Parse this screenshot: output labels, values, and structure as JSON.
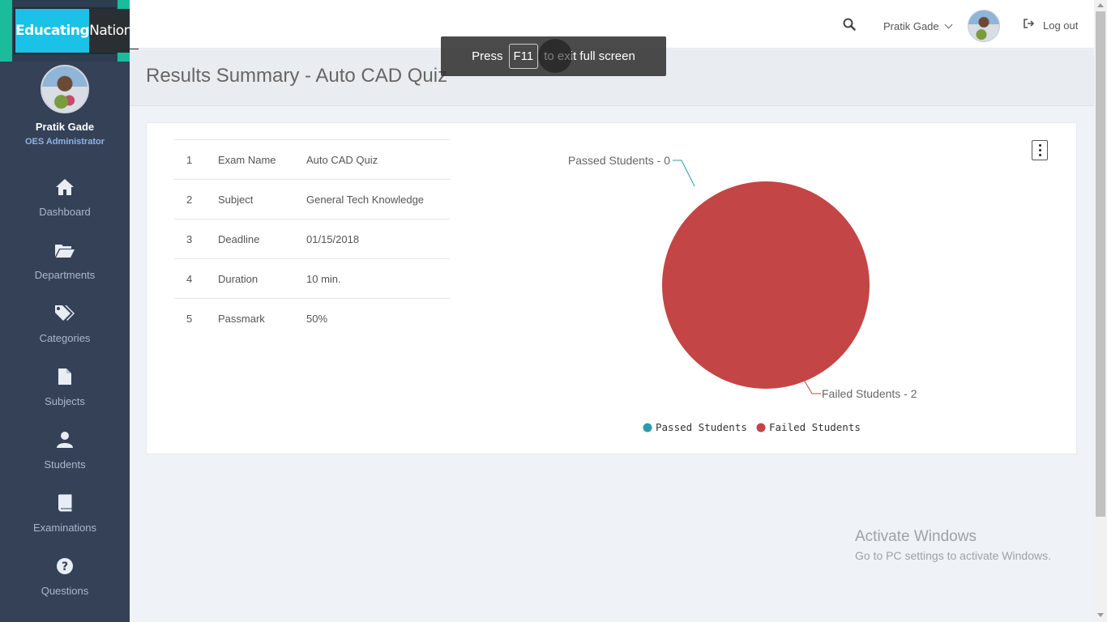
{
  "brand": {
    "logo_left": "Educating",
    "logo_right": "Nations"
  },
  "profile": {
    "name": "Pratik Gade",
    "role": "OES Administrator"
  },
  "nav": [
    {
      "label": "Dashboard",
      "icon": "home-icon"
    },
    {
      "label": "Departments",
      "icon": "folder-open-icon"
    },
    {
      "label": "Categories",
      "icon": "tags-icon"
    },
    {
      "label": "Subjects",
      "icon": "file-icon"
    },
    {
      "label": "Students",
      "icon": "user-icon"
    },
    {
      "label": "Examinations",
      "icon": "book-icon"
    },
    {
      "label": "Questions",
      "icon": "question-circle-icon"
    }
  ],
  "topbar": {
    "user_name": "Pratik Gade",
    "logout_label": "Log out"
  },
  "page": {
    "title": "Results Summary - Auto CAD Quiz"
  },
  "details": [
    {
      "num": "1",
      "key": "Exam Name",
      "value": "Auto CAD Quiz"
    },
    {
      "num": "2",
      "key": "Subject",
      "value": "General Tech Knowledge"
    },
    {
      "num": "3",
      "key": "Deadline",
      "value": "01/15/2018"
    },
    {
      "num": "4",
      "key": "Duration",
      "value": "10 min."
    },
    {
      "num": "5",
      "key": "Passmark",
      "value": "50%"
    }
  ],
  "chart_data": {
    "type": "pie",
    "title": "",
    "series": [
      {
        "name": "Passed Students",
        "value": 0,
        "label": "Passed Students - 0",
        "color": "#2e9aae"
      },
      {
        "name": "Failed Students",
        "value": 2,
        "label": "Failed Students - 2",
        "color": "#c44545"
      }
    ],
    "legend_position": "bottom"
  },
  "fullscreen_toast": {
    "prefix": "Press",
    "key": "F11",
    "suffix": "to exit full screen"
  },
  "watermark": {
    "title": "Activate Windows",
    "subtitle": "Go to PC settings to activate Windows."
  }
}
